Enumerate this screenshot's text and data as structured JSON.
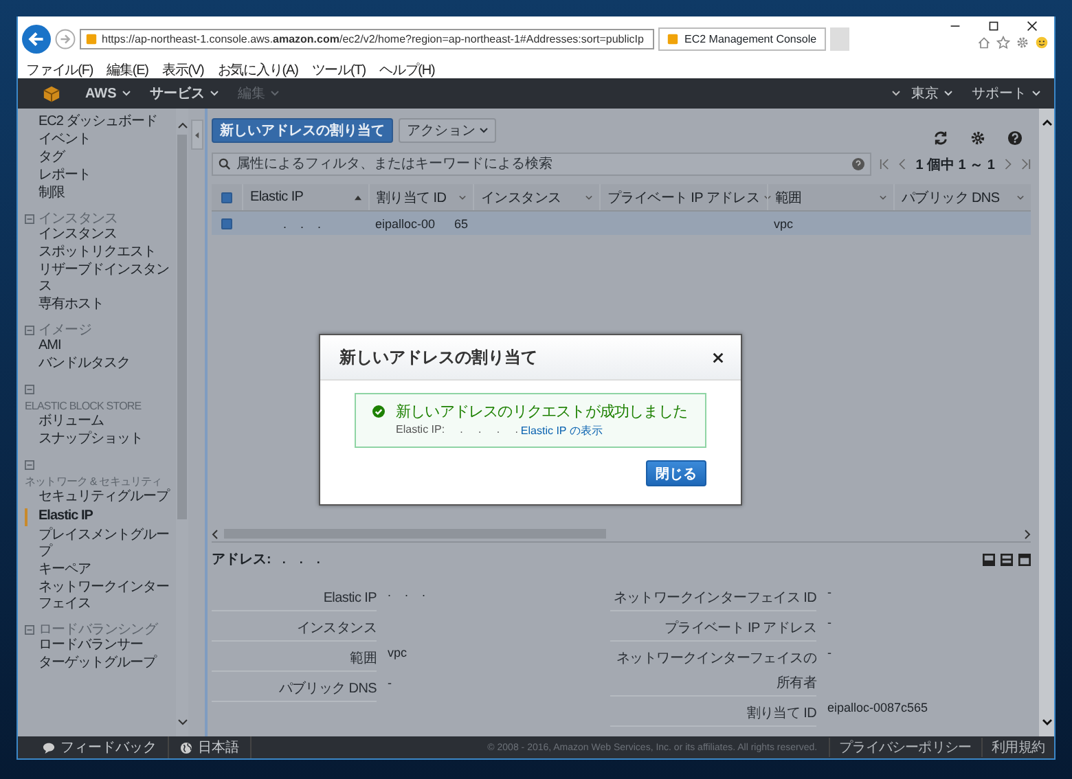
{
  "browser": {
    "url": "https://ap-northeast-1.console.aws.**amazon.com**/ec2/v2/home?region=ap-northeast-1#Addresses:sort=publicIp",
    "tab_title": "EC2 Management Console",
    "menu": [
      "ファイル(F)",
      "編集(E)",
      "表示(V)",
      "お気に入り(A)",
      "ツール(T)",
      "ヘルプ(H)"
    ]
  },
  "nav": {
    "items": [
      {
        "label": "AWS",
        "disabled": false
      },
      {
        "label": "サービス",
        "disabled": false
      },
      {
        "label": "編集",
        "disabled": true
      }
    ],
    "right": [
      "東京",
      "サポート"
    ]
  },
  "sidebar": {
    "sections": [
      {
        "kind": "plain",
        "items": [
          {
            "label": "EC2 ダッシュボード",
            "selected": false
          },
          {
            "label": "イベント",
            "selected": false
          },
          {
            "label": "タグ",
            "selected": false
          },
          {
            "label": "レポート",
            "selected": false
          },
          {
            "label": "制限",
            "selected": false
          }
        ]
      },
      {
        "kind": "inline",
        "heading": "インスタンス",
        "expanded": true,
        "items": [
          {
            "label": "インスタンス",
            "selected": false
          },
          {
            "label": "スポットリクエスト",
            "selected": false
          },
          {
            "label": "リザーブドインスタンス",
            "selected": false
          },
          {
            "label": "専有ホスト",
            "selected": false
          }
        ]
      },
      {
        "kind": "inline",
        "heading": "イメージ",
        "expanded": true,
        "items": [
          {
            "label": "AMI",
            "selected": false
          },
          {
            "label": "バンドルタスク",
            "selected": false
          }
        ]
      },
      {
        "kind": "below",
        "heading": "ELASTIC BLOCK STORE",
        "expanded": true,
        "items": [
          {
            "label": "ボリューム",
            "selected": false
          },
          {
            "label": "スナップショット",
            "selected": false
          }
        ]
      },
      {
        "kind": "below",
        "heading": "ネットワーク & セキュリティ",
        "expanded": true,
        "items": [
          {
            "label": "セキュリティグループ",
            "selected": false
          },
          {
            "label": "Elastic IP",
            "selected": true
          },
          {
            "label": "プレイスメントグループ",
            "selected": false
          },
          {
            "label": "キーペア",
            "selected": false
          },
          {
            "label": "ネットワークインターフェイス",
            "selected": false
          }
        ]
      },
      {
        "kind": "inline",
        "heading": "ロードバランシング",
        "expanded": true,
        "items": [
          {
            "label": "ロードバランサー",
            "selected": false
          },
          {
            "label": "ターゲットグループ",
            "selected": false
          }
        ]
      }
    ]
  },
  "toolbar": {
    "primary": "新しいアドレスの割り当て",
    "actions": "アクション"
  },
  "search": {
    "placeholder": "属性によるフィルタ、またはキーワードによる検索"
  },
  "pagination": "1 個中 1 ～ 1",
  "table": {
    "all_checked": true,
    "columns": [
      {
        "label": "Elastic IP",
        "sorted": true
      },
      {
        "label": "割り当て ID",
        "sorted": false
      },
      {
        "label": "インスタンス",
        "sorted": false
      },
      {
        "label": "プライベート IP アドレス",
        "sorted": false
      },
      {
        "label": "範囲",
        "sorted": false
      },
      {
        "label": "パブリック DNS",
        "sorted": false
      }
    ],
    "rows": [
      {
        "selected": true,
        "checked": true,
        "elastic_ip": ".    .    .",
        "allocation_id": "eipalloc-00",
        "allocation_id_end": "65",
        "scope": "vpc"
      }
    ]
  },
  "modal": {
    "title": "新しいアドレスの割り当て",
    "message": "新しいアドレスのリクエストが成功しました",
    "detail": "Elastic IP:     .     .     .     .",
    "link": "Elastic IP の表示",
    "button": "閉じる"
  },
  "details": {
    "heading": "アドレス:",
    "heading_value": ".    .    .",
    "left": [
      {
        "label": "Elastic IP",
        "value": ".    .    ."
      },
      {
        "label": "インスタンス"
      },
      {
        "label": "範囲",
        "value": "vpc"
      },
      {
        "label": "パブリック DNS",
        "value": "-"
      }
    ],
    "right": [
      {
        "label": "ネットワークインターフェイス ID",
        "value": "-"
      },
      {
        "label": "プライベート IP アドレス",
        "value": "-"
      },
      {
        "label": "ネットワークインターフェイスの所有者",
        "value": "-"
      },
      {
        "label": "割り当て ID",
        "value": "eipalloc-0087c565"
      }
    ]
  },
  "footer": {
    "feedback": "フィードバック",
    "language": "日本語",
    "copyright": "© 2008 - 2016, Amazon Web Services, Inc. or its affiliates. All rights reserved.",
    "links": [
      "プライバシーポリシー",
      "利用規約"
    ]
  }
}
